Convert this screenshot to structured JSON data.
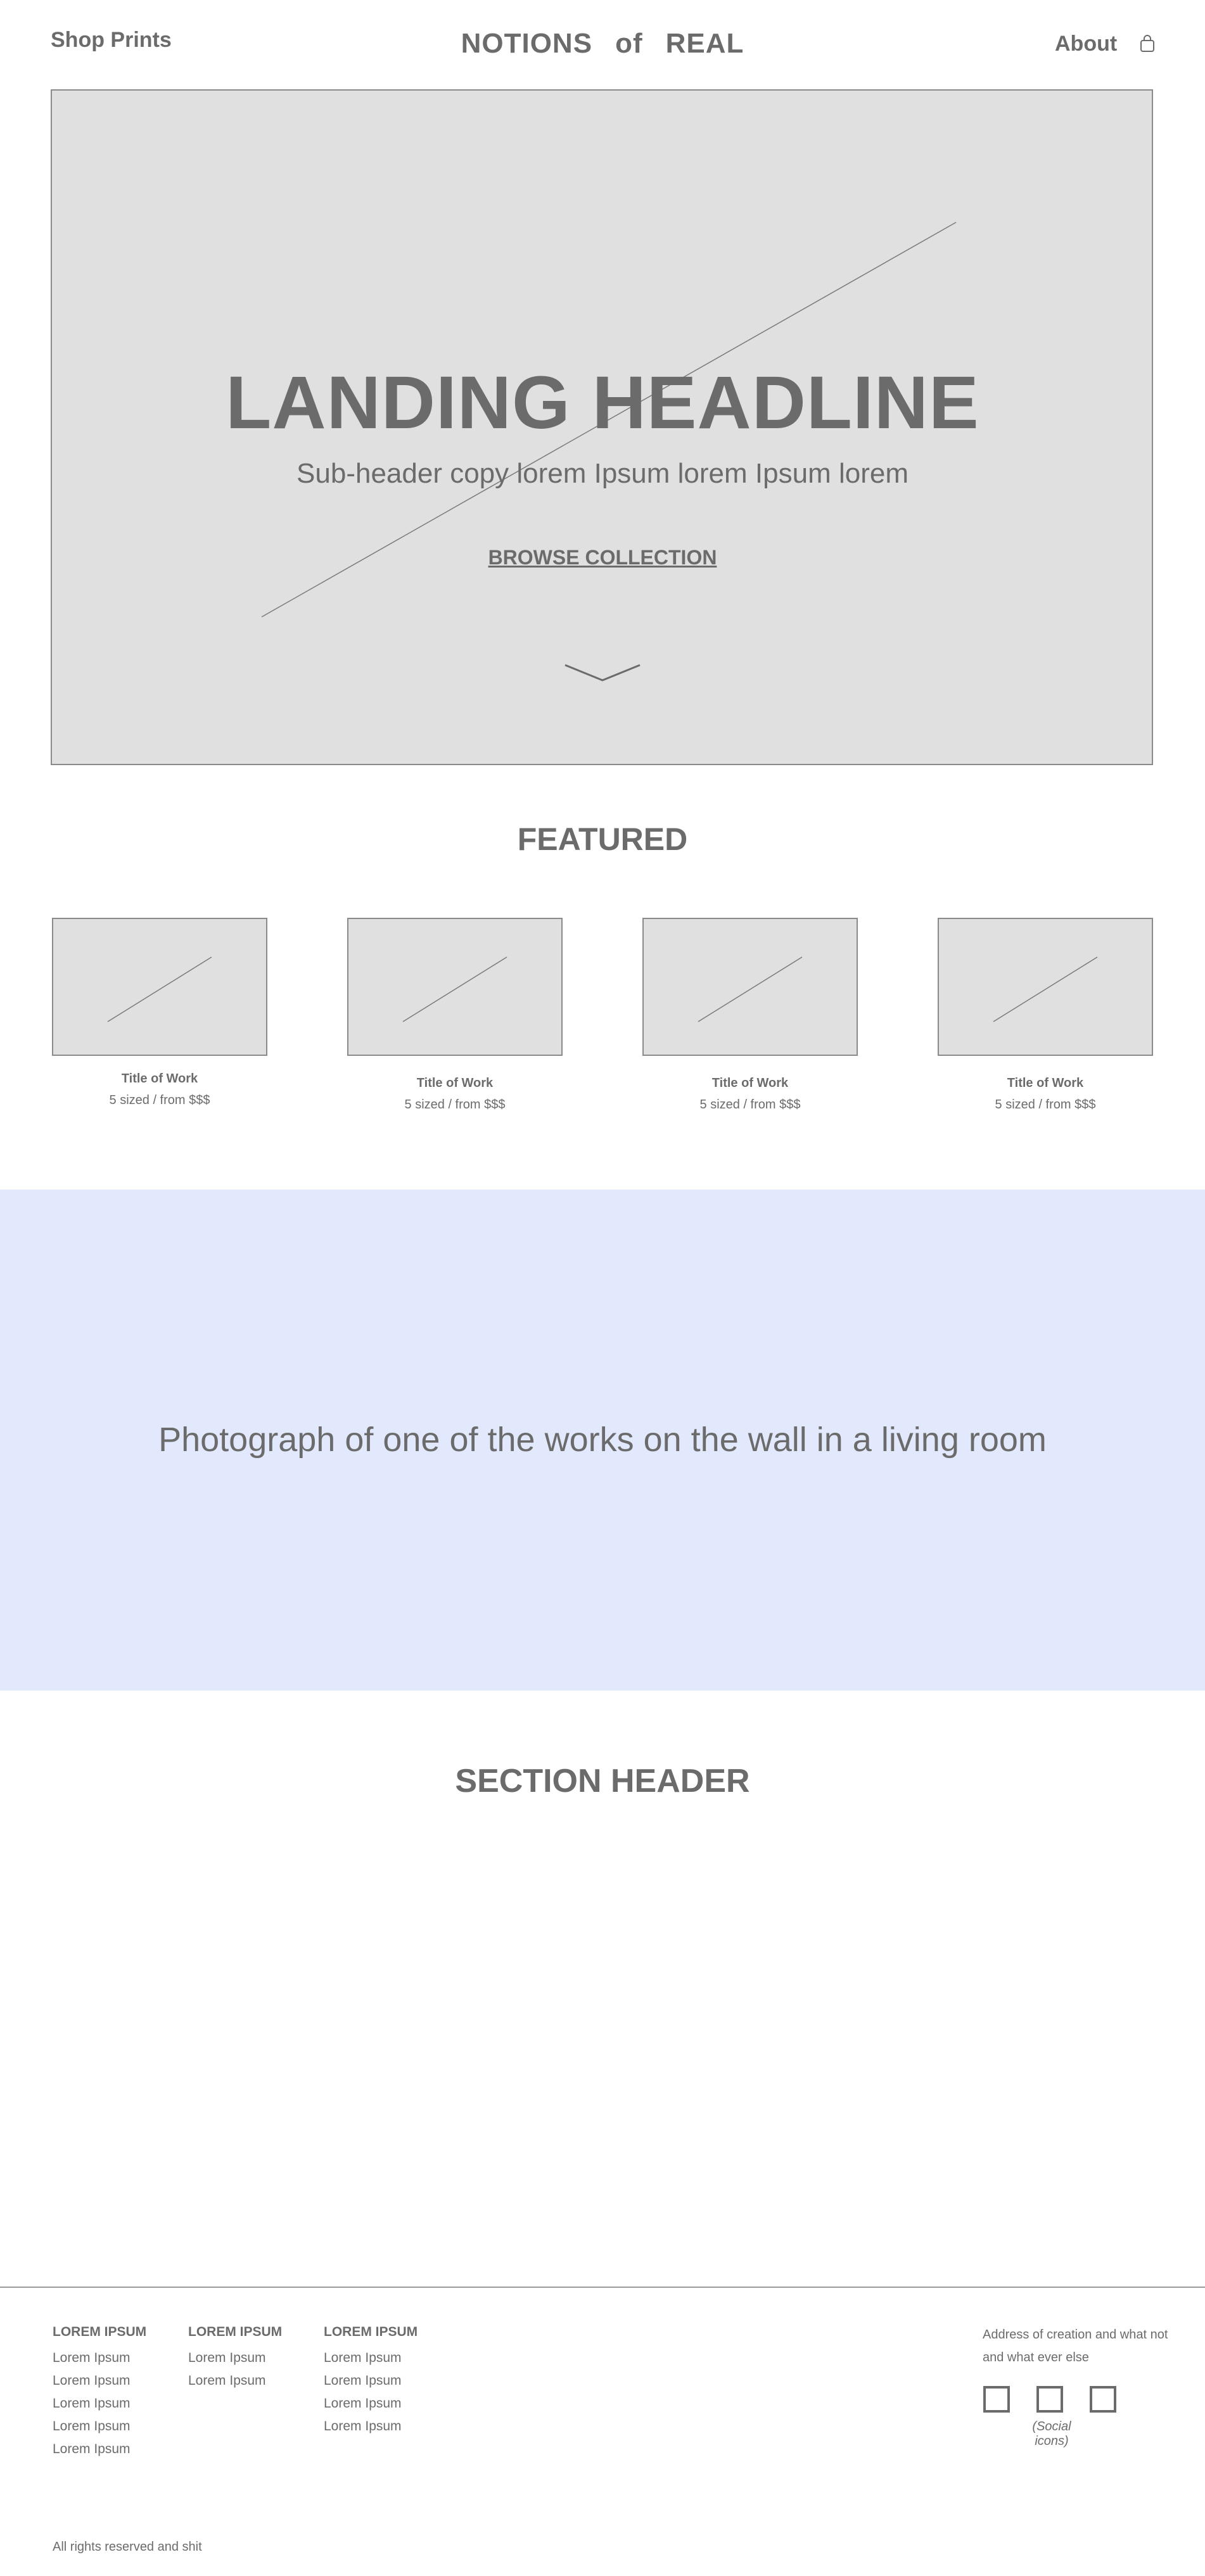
{
  "header": {
    "shop_link": "Shop Prints",
    "brand": [
      "NOTIONS",
      "of",
      "REAL"
    ],
    "about_link": "About",
    "cart_icon": "shopping-bag-icon"
  },
  "hero": {
    "headline": "LANDING HEADLINE",
    "subheader": "Sub-header copy lorem Ipsum lorem Ipsum lorem",
    "cta": "BROWSE COLLECTION",
    "scroll_icon": "chevron-down-icon"
  },
  "featured": {
    "title": "FEATURED",
    "items": [
      {
        "title": "Title of Work",
        "price": "5 sized / from $$$"
      },
      {
        "title": "Title of Work",
        "price": "5 sized / from $$$"
      },
      {
        "title": "Title of Work",
        "price": "5 sized / from $$$"
      },
      {
        "title": "Title of Work",
        "price": "5 sized / from $$$"
      }
    ]
  },
  "photo_band": {
    "text": "Photograph of one of the works on the wall in a living room",
    "color": "#e2e9fc"
  },
  "section": {
    "header": "SECTION HEADER"
  },
  "footer": {
    "columns": [
      {
        "heading": "LOREM IPSUM",
        "items": [
          "Lorem Ipsum",
          "Lorem Ipsum",
          "Lorem Ipsum",
          "Lorem Ipsum",
          "Lorem Ipsum"
        ]
      },
      {
        "heading": "LOREM IPSUM",
        "items": [
          "Lorem Ipsum",
          "Lorem Ipsum"
        ]
      },
      {
        "heading": "LOREM IPSUM",
        "items": [
          "Lorem Ipsum",
          "Lorem Ipsum",
          "Lorem Ipsum",
          "Lorem Ipsum"
        ]
      }
    ],
    "address": "Address of creation and what not and what ever else",
    "social_caption": "(Social icons)",
    "copyright": "All rights reserved and shit"
  },
  "colors": {
    "text": "#6b6b6b",
    "placeholder": "#e0e0e0",
    "border": "#8a8a8a"
  }
}
